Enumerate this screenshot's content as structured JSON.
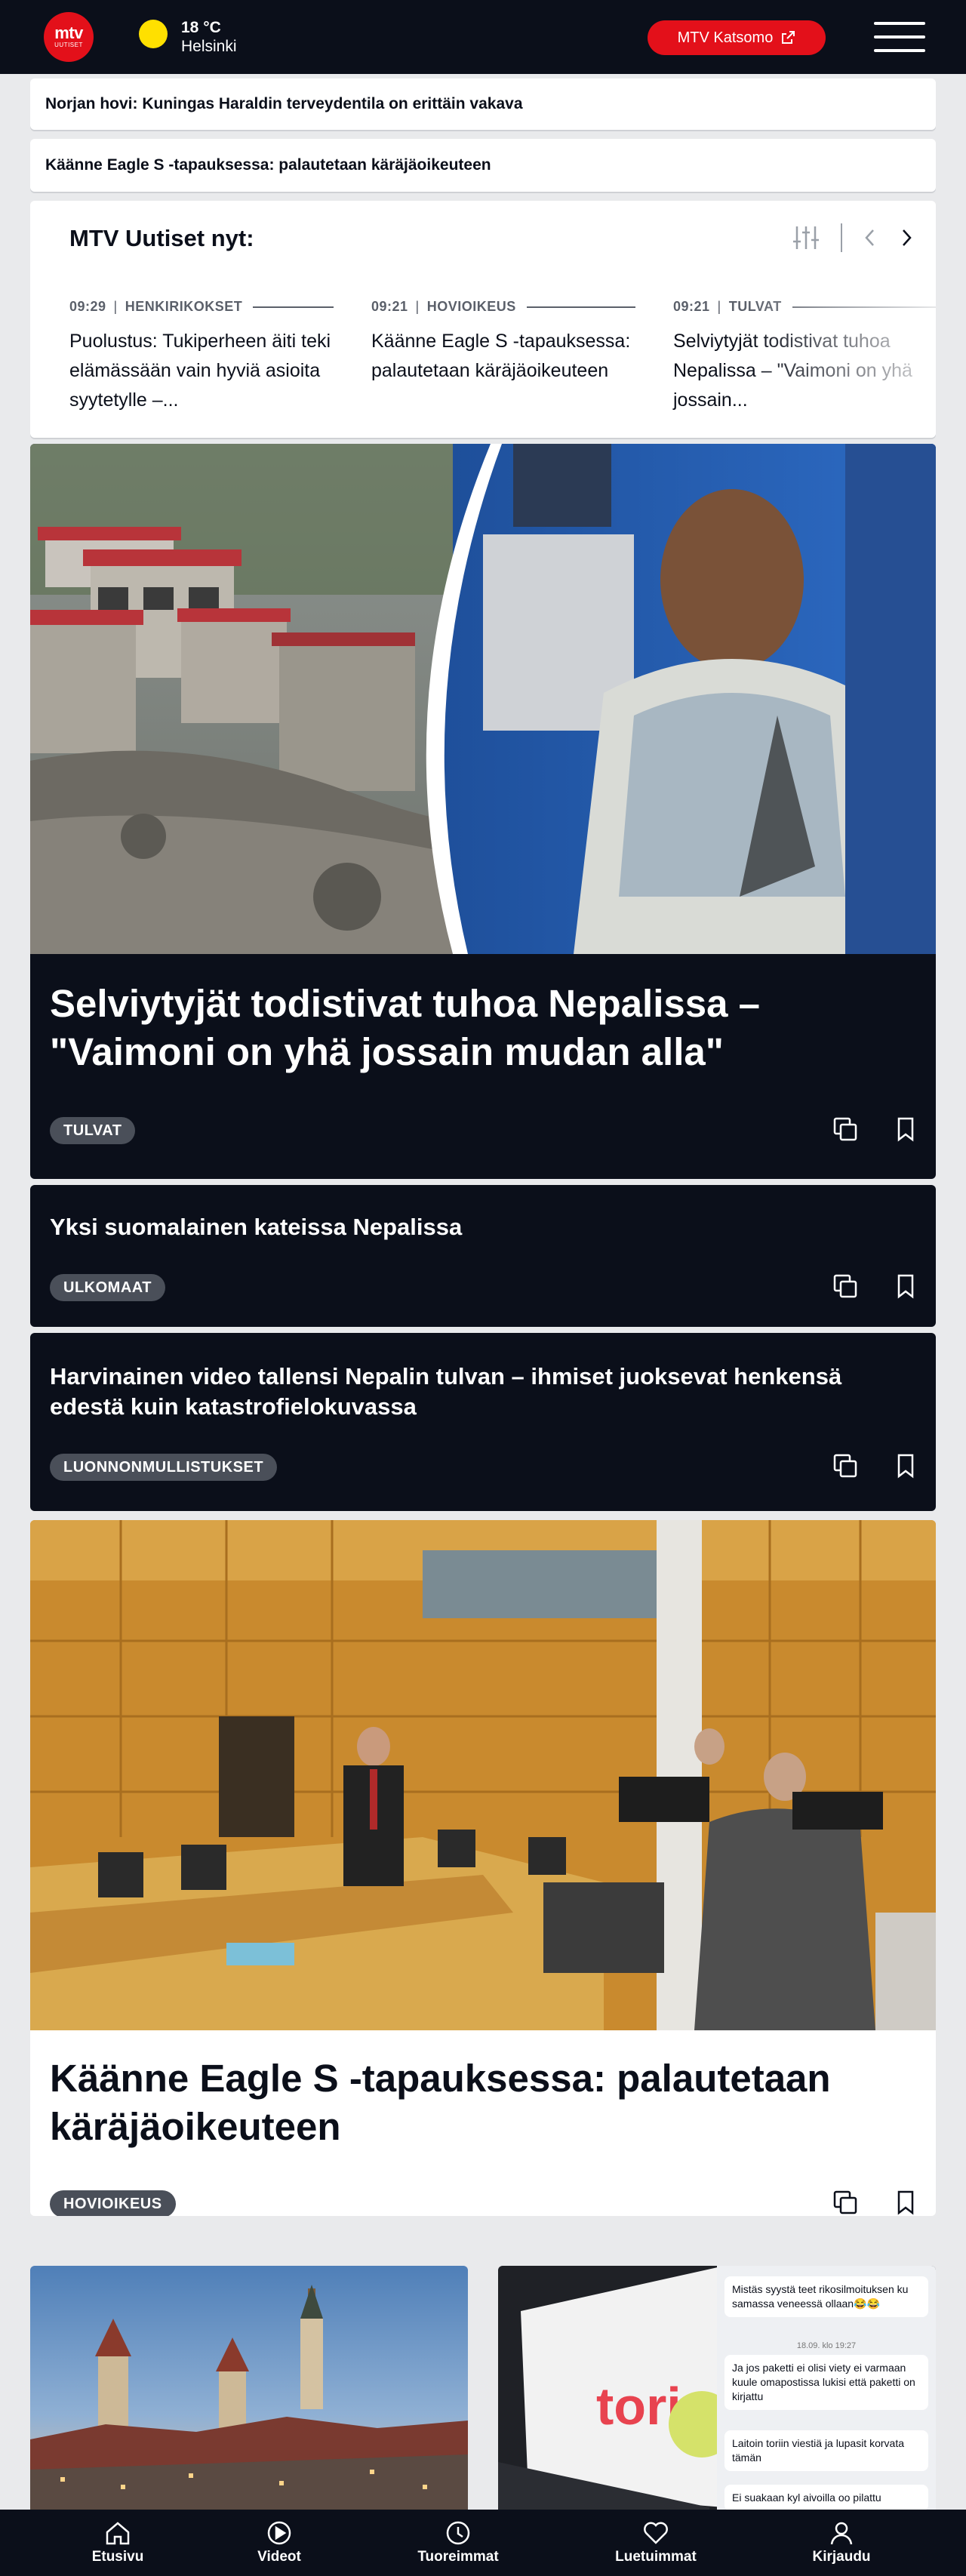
{
  "header": {
    "logo_line1": "mtv",
    "logo_line2": "UUTISET",
    "temperature": "18 °C",
    "city": "Helsinki",
    "katsomo_label": "MTV Katsomo"
  },
  "alerts": [
    {
      "text": "Norjan hovi: Kuningas Haraldin terveydentila on erittäin vakava"
    },
    {
      "text": "Käänne Eagle S -tapauksessa: palautetaan käräjäoikeuteen"
    }
  ],
  "now": {
    "title": "MTV Uutiset nyt:",
    "items": [
      {
        "time": "09:29",
        "category": "HENKIRIKOKSET",
        "title": "Puolustus: Tukiperheen äiti teki elämässään vain hyviä asioita syytetylle –..."
      },
      {
        "time": "09:21",
        "category": "HOVIOIKEUS",
        "title": "Käänne Eagle S -tapauksessa: palautetaan käräjäoikeuteen"
      },
      {
        "time": "09:21",
        "category": "TULVAT",
        "title": "Selviytyjät todistivat tuhoa Nepalissa – \"Vaimoni on yhä jossain..."
      }
    ]
  },
  "stories": [
    {
      "title": "Selviytyjät todistivat tuhoa Nepalissa – \"Vaimoni on yhä jossain mudan alla\"",
      "tag": "TULVAT"
    },
    {
      "title": "Yksi suomalainen kateissa Nepalissa",
      "tag": "ULKOMAAT"
    },
    {
      "title": "Harvinainen video tallensi Nepalin tulvan – ihmiset juoksevat henkensä edestä kuin katastrofielokuvassa",
      "tag": "LUONNONMULLISTUKSET"
    },
    {
      "title": "Käänne Eagle S -tapauksessa: palautetaan käräjäoikeuteen",
      "tag": "HOVIOIKEUS"
    }
  ],
  "tile_chat": {
    "msg1": "Mistäs syystä teet rikosilmoituksen ku samassa veneessä ollaan😂😂",
    "date": "18.09. klo 19:27",
    "msg2": "Ja jos paketti ei olisi viety ei varmaan kuule omapostissa lukisi että paketti on kirjattu",
    "msg3": "Laitoin toriin viestiä ja lupasit korvata tämän",
    "msg4": "Ei suakaan kyl aivoilla oo pilattu",
    "screen_text": "tori"
  },
  "nav": [
    {
      "label": "Etusivu"
    },
    {
      "label": "Videot"
    },
    {
      "label": "Tuoreimmat"
    },
    {
      "label": "Luetuimmat"
    },
    {
      "label": "Kirjaudu"
    }
  ],
  "colors": {
    "brand_red": "#e3101a",
    "dark": "#0b0f1a",
    "tag_gray": "#4a4f59",
    "sun": "#ffe000"
  }
}
